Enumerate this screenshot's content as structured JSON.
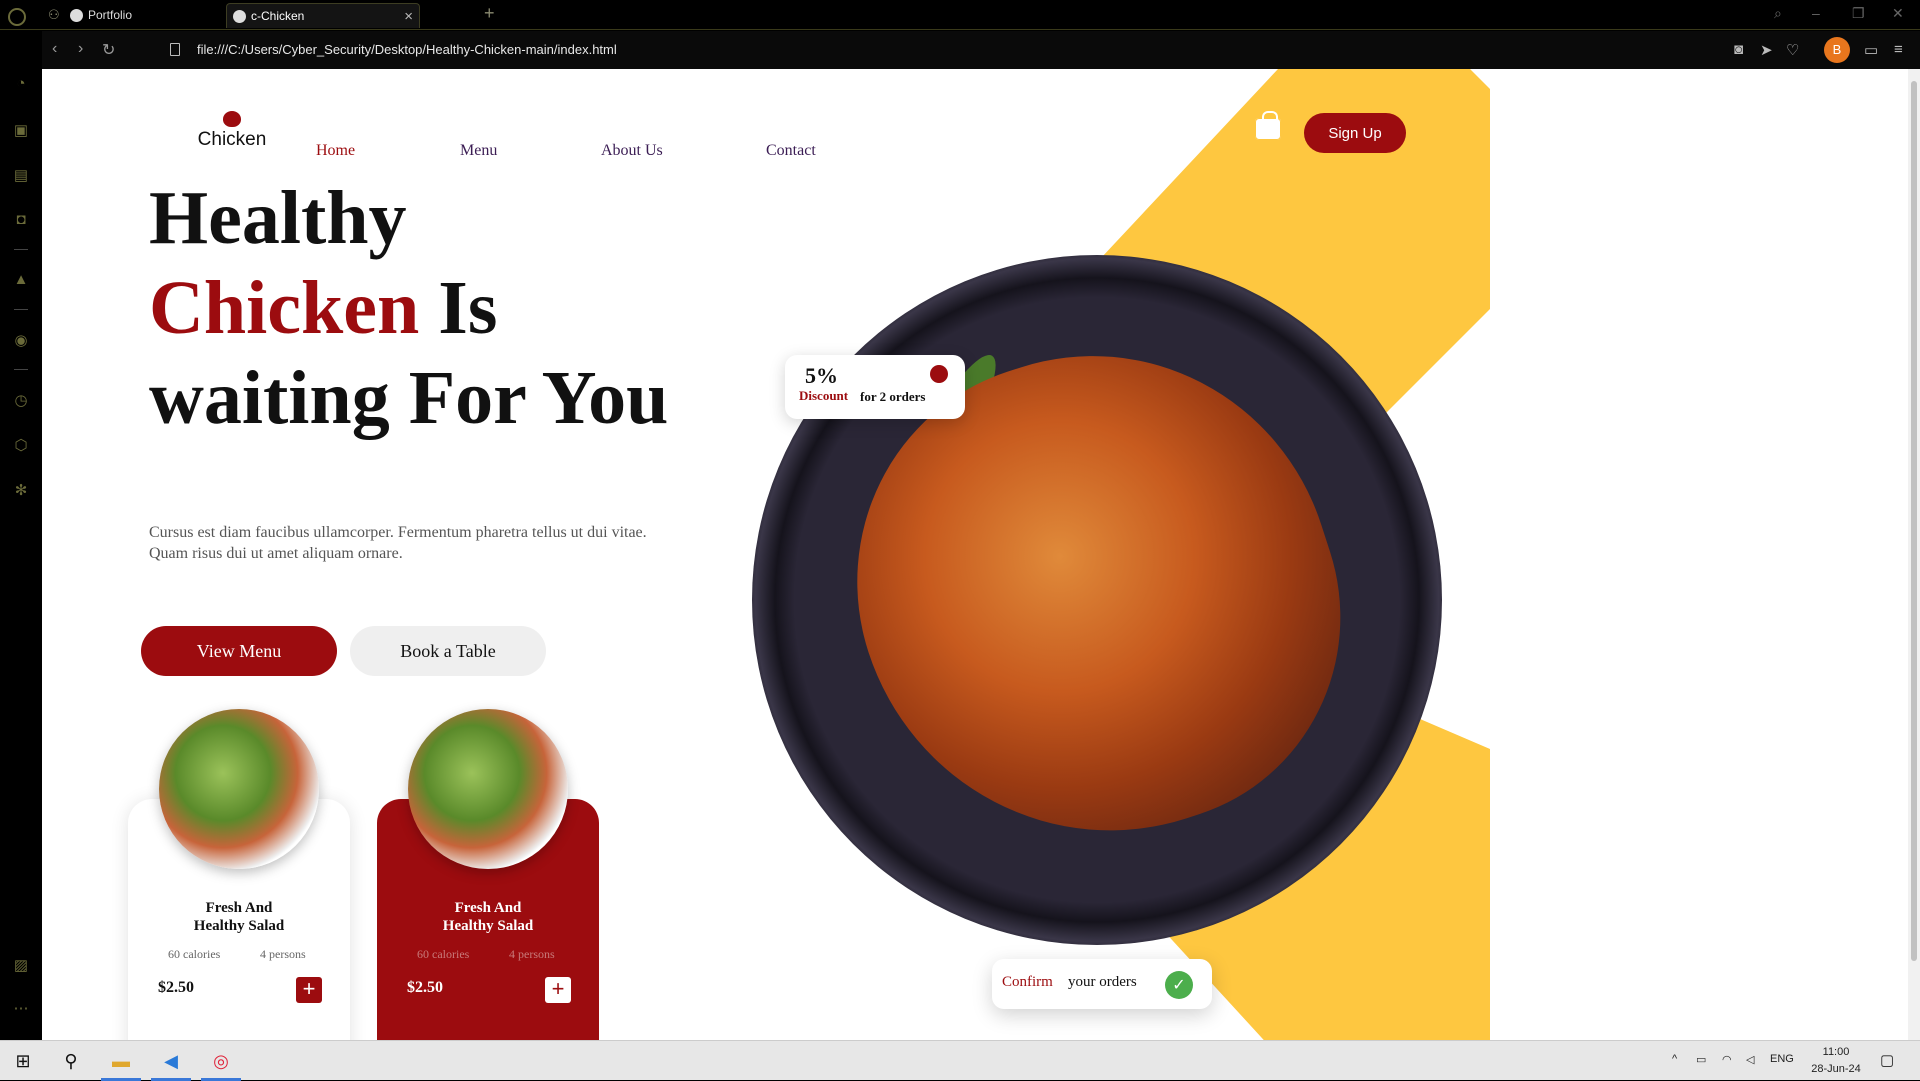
{
  "browser": {
    "tabs": [
      {
        "label": "Portfolio",
        "active": false
      },
      {
        "label": "c-Chicken",
        "active": true
      }
    ],
    "url": "file:///C:/Users/Cyber_Security/Desktop/Healthy-Chicken-main/index.html",
    "profile_initial": "B"
  },
  "site": {
    "logo_text": "Chicken",
    "nav": [
      "Home",
      "Menu",
      "About Us",
      "Contact"
    ],
    "signup_label": "Sign Up",
    "hero": {
      "line1": "Healthy",
      "line2_red": "Chicken",
      "line2_rest": " Is",
      "line3": "waiting For You",
      "description": "Cursus est diam faucibus ullamcorper. Fermentum pharetra tellus ut dui vitae. Quam risus dui ut amet aliquam ornare."
    },
    "buttons": {
      "view_menu": "View Menu",
      "book_table": "Book a Table"
    },
    "cards": [
      {
        "title_l1": "Fresh And",
        "title_l2": "Healthy Salad",
        "calories": "60 calories",
        "persons": "4 persons",
        "price": "$2.50",
        "add": "+"
      },
      {
        "title_l1": "Fresh And",
        "title_l2": "Healthy Salad",
        "calories": "60 calories",
        "persons": "4 persons",
        "price": "$2.50",
        "add": "+"
      }
    ],
    "discount": {
      "percent": "5%",
      "label": "Discount",
      "orders": "for 2 orders"
    },
    "confirm": {
      "label": "Confirm",
      "rest": "your orders",
      "check": "✓"
    }
  },
  "taskbar": {
    "lang": "ENG",
    "time": "11:00",
    "date": "28-Jun-24"
  },
  "colors": {
    "accent_red": "#9c0c0f",
    "accent_yellow": "#fec740"
  }
}
